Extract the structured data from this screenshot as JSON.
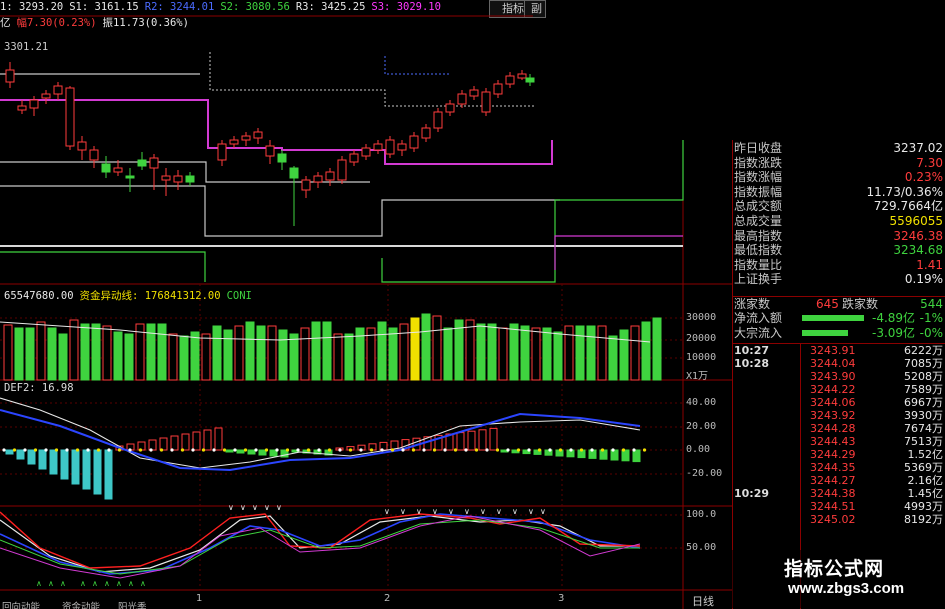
{
  "header": {
    "line1": [
      {
        "text": "1: 3293.20",
        "color": "#e8e8e8"
      },
      {
        "text": "S1: 3161.15",
        "color": "#e8e8e8"
      },
      {
        "text": "R2: 3244.01",
        "color": "#4b6bff"
      },
      {
        "text": "S2: 3080.56",
        "color": "#3fd33f"
      },
      {
        "text": "R3: 3425.25",
        "color": "#e8e8e8"
      },
      {
        "text": "S3: 3029.10",
        "color": "#ff39ff"
      }
    ],
    "line2": [
      {
        "text": "亿",
        "color": "#e8e8e8"
      },
      {
        "text": "幅7.30(0.23%)",
        "color": "#ff3c3c"
      },
      {
        "text": "振11.73(0.36%)",
        "color": "#e8e8e8"
      }
    ],
    "price_label": "3301.21",
    "btn_indicator": "指标",
    "btn_extra": "副"
  },
  "volume_panel": {
    "header": [
      {
        "text": "65547680.00",
        "color": "#e8e8e8"
      },
      {
        "text": "资金异动线: 176841312.00",
        "color": "#f0e000"
      },
      {
        "text": "CONI",
        "color": "#3fd33f"
      }
    ],
    "axis": [
      "30000",
      "20000",
      "10000"
    ],
    "unit": "X1万"
  },
  "macd_panel": {
    "header": "DEF2: 16.98",
    "axis": [
      "40.00",
      "20.00",
      "0.00",
      "-20.00"
    ]
  },
  "kdj_panel": {
    "axis": [
      "100.0",
      "50.00"
    ]
  },
  "bottom": {
    "tabs": [
      "回向动能",
      "资金动能",
      "阳光季"
    ],
    "dates": [
      "1",
      "2",
      "3"
    ],
    "period": "日线"
  },
  "right_panel": {
    "stats": [
      {
        "label": "昨日收盘",
        "value": "3237.02",
        "color": "#e8e8e8"
      },
      {
        "label": "指数涨跌",
        "value": "7.30",
        "color": "#ff3c3c"
      },
      {
        "label": "指数涨幅",
        "value": "0.23%",
        "color": "#ff3c3c"
      },
      {
        "label": "指数振幅",
        "value": "11.73/0.36%",
        "color": "#e8e8e8"
      },
      {
        "label": "总成交额",
        "value": "729.7664亿",
        "color": "#e8e8e8"
      },
      {
        "label": "总成交量",
        "value": "5596055",
        "color": "#f0e000"
      },
      {
        "label": "最高指数",
        "value": "3246.38",
        "color": "#ff3c3c"
      },
      {
        "label": "最低指数",
        "value": "3234.68",
        "color": "#3fd33f"
      },
      {
        "label": "指数量比",
        "value": "1.41",
        "color": "#ff3c3c"
      },
      {
        "label": "上证换手",
        "value": "0.19%",
        "color": "#e8e8e8"
      }
    ],
    "rise_fall": {
      "rise_label": "涨家数",
      "rise_value": "645",
      "fall_label": "跌家数",
      "fall_value": "544"
    },
    "flows": [
      {
        "label": "净流入额",
        "value": "-4.89亿",
        "pct": "-1%"
      },
      {
        "label": "大宗流入",
        "value": "-3.09亿",
        "pct": "-0%"
      }
    ],
    "ticks": [
      {
        "time": "10:27",
        "price": "3243.91",
        "vol": "6222万"
      },
      {
        "time": "10:28",
        "price": "3244.04",
        "vol": "7085万"
      },
      {
        "time": "",
        "price": "3243.90",
        "vol": "5208万"
      },
      {
        "time": "",
        "price": "3244.22",
        "vol": "7589万"
      },
      {
        "time": "",
        "price": "3244.06",
        "vol": "6967万"
      },
      {
        "time": "",
        "price": "3243.92",
        "vol": "3930万"
      },
      {
        "time": "",
        "price": "3244.28",
        "vol": "7674万"
      },
      {
        "time": "",
        "price": "3244.43",
        "vol": "7513万"
      },
      {
        "time": "",
        "price": "3244.29",
        "vol": "1.52亿"
      },
      {
        "time": "",
        "price": "3244.35",
        "vol": "5369万"
      },
      {
        "time": "",
        "price": "3244.27",
        "vol": "2.16亿"
      },
      {
        "time": "10:29",
        "price": "3244.38",
        "vol": "1.45亿"
      },
      {
        "time": "",
        "price": "3244.51",
        "vol": "4993万"
      },
      {
        "time": "",
        "price": "3245.02",
        "vol": "8192万"
      }
    ]
  },
  "watermark": {
    "line1": "指标公式网",
    "line2": "www.zbgs3.com"
  },
  "colors": {
    "up": "#ff3c3c",
    "down": "#3fd33f",
    "bg": "#000000",
    "grid": "#8b0000"
  }
}
